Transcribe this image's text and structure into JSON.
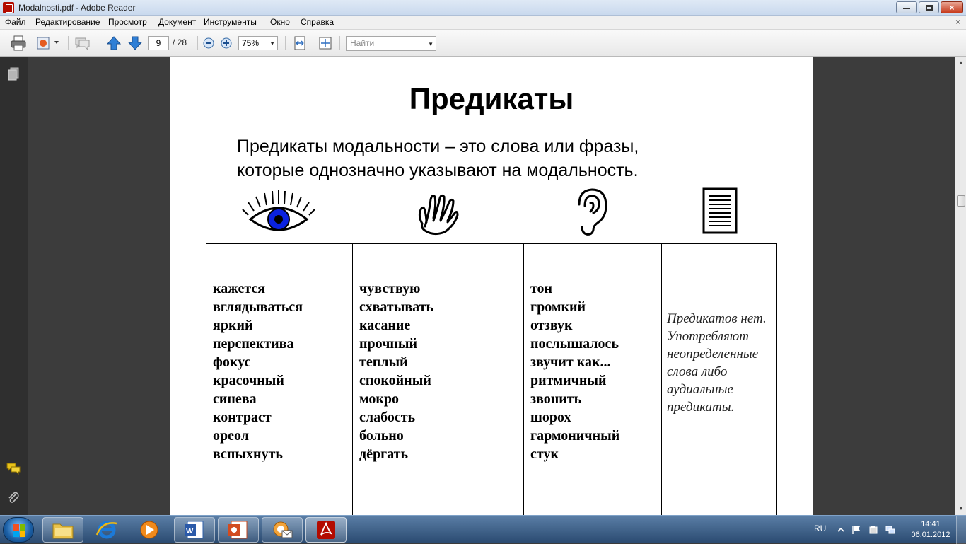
{
  "window": {
    "title": "Modalnosti.pdf - Adobe Reader"
  },
  "menu": {
    "items": [
      "Файл",
      "Редактирование",
      "Просмотр",
      "Документ",
      "Инструменты",
      "Окно",
      "Справка"
    ],
    "close_glyph": "×"
  },
  "toolbar": {
    "page_current": "9",
    "page_total": "/ 28",
    "zoom": "75%",
    "find_placeholder": "Найти",
    "caret": "▼"
  },
  "document": {
    "heading": "Предикаты",
    "intro_line1": "Предикаты модальности – это слова или фразы,",
    "intro_line2": "которые однозначно указывают на модальность.",
    "columns": [
      {
        "icon": "eye-icon",
        "words": [
          "кажется",
          "вглядываться",
          "яркий",
          "перспектива",
          "фокус",
          "красочный",
          "синева",
          "контраст",
          "ореол",
          "вспыхнуть"
        ]
      },
      {
        "icon": "hand-icon",
        "words": [
          "чувствую",
          "схватывать",
          "касание",
          "прочный",
          "теплый",
          "спокойный",
          "мокро",
          "слабость",
          "больно",
          "дёргать"
        ]
      },
      {
        "icon": "ear-icon",
        "words": [
          "тон",
          "громкий",
          "отзвук",
          "послышалось",
          "звучит как...",
          "ритмичный",
          "звонить",
          "шорох",
          "гармоничный",
          "стук"
        ]
      },
      {
        "icon": "document-icon",
        "note": "Предикатов нет. Употребляют неопределенные слова либо аудиальные предикаты."
      }
    ],
    "eye_color": "#0a22e0"
  },
  "taskbar": {
    "language": "RU",
    "time": "14:41",
    "date": "06.01.2012",
    "buttons": [
      "explorer-icon",
      "internet-explorer-icon",
      "media-player-icon",
      "word-icon",
      "powerpoint-icon",
      "mail-icon",
      "adobe-reader-icon"
    ]
  },
  "colors": {
    "adobe_red": "#b30b00",
    "doc_background": "#3c3c3c"
  }
}
